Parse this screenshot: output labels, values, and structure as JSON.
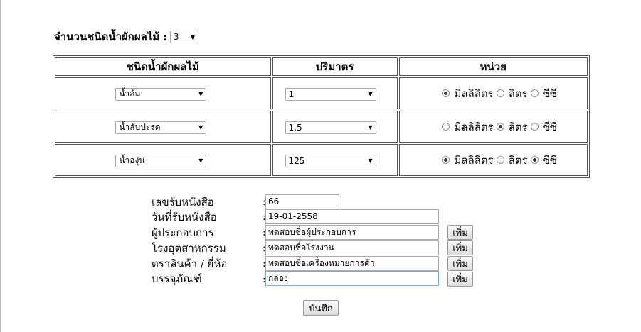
{
  "count": {
    "label": "จำนวนชนิดน้ำผักผลไม้ :",
    "value": "3"
  },
  "table": {
    "headers": [
      "ชนิดน้ำผักผลไม้",
      "ปริมาตร",
      "หน่วย"
    ],
    "units": [
      "มิลลิลิตร",
      "ลิตร",
      "ซีซี"
    ],
    "rows": [
      {
        "juice": "น้ำส้ม",
        "qty": "1",
        "units_checked": [
          true,
          false,
          false
        ]
      },
      {
        "juice": "น้ำสับปะรด",
        "qty": "1.5",
        "units_checked": [
          false,
          true,
          false
        ]
      },
      {
        "juice": "น้ำองุ่น",
        "qty": "125",
        "units_checked": [
          true,
          false,
          true
        ]
      }
    ]
  },
  "form": {
    "colon": ":",
    "fields": [
      {
        "label": "เลขรับหนังสือ",
        "value": "66"
      },
      {
        "label": "วันที่รับหนังสือ",
        "value": "19-01-2558"
      },
      {
        "label": "ผู้ประกอบการ",
        "value": "ทดสอบชื่อผู้ประกอบการ"
      },
      {
        "label": "โรงอุตสาหกรรม",
        "value": "ทดสอบชื่อโรงงาน"
      },
      {
        "label": "ตราสินค้า / ยี่ห้อ",
        "value": "ทดสอบชื่อเครื่องหมายการค้า"
      },
      {
        "label": "บรรจุภัณฑ์",
        "value": "กล่อง"
      }
    ],
    "add_label": "เพิ่ม",
    "save_label": "บันทึก"
  },
  "icons": {
    "dropdown": "chevron-down-icon"
  },
  "colors": {
    "focus_border": "#7ba7d9",
    "border": "#555555"
  }
}
